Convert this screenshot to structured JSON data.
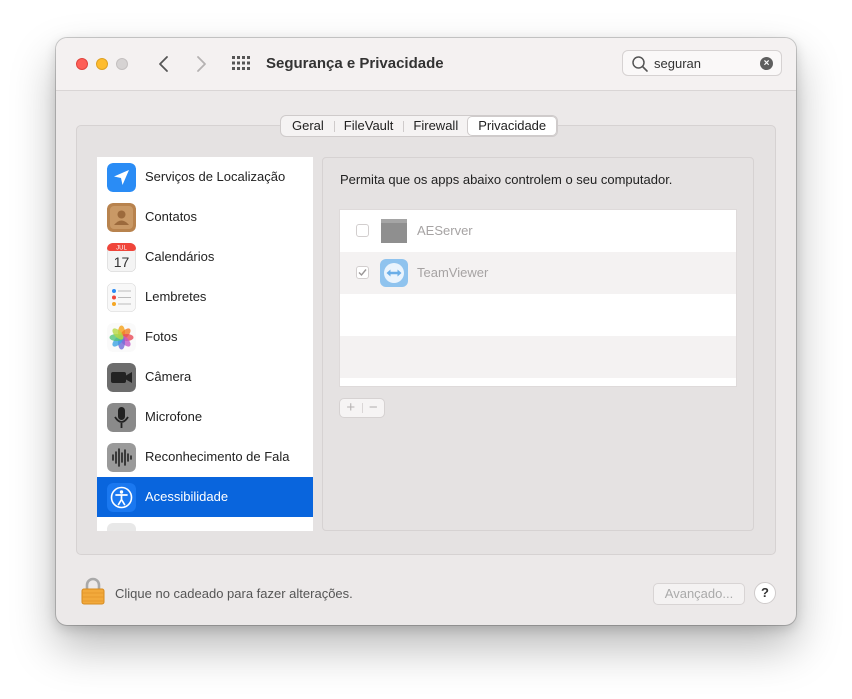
{
  "window": {
    "title": "Segurança e Privacidade"
  },
  "search": {
    "value": "seguran",
    "clear_glyph": "×"
  },
  "tabs": [
    {
      "label": "Geral",
      "selected": false
    },
    {
      "label": "FileVault",
      "selected": false
    },
    {
      "label": "Firewall",
      "selected": false
    },
    {
      "label": "Privacidade",
      "selected": true
    }
  ],
  "sidebar": {
    "items": [
      {
        "label": "Serviços de Localização",
        "icon": "location-icon"
      },
      {
        "label": "Contatos",
        "icon": "contacts-icon"
      },
      {
        "label": "Calendários",
        "icon": "calendar-icon",
        "icon_month": "JUL",
        "icon_day": "17"
      },
      {
        "label": "Lembretes",
        "icon": "reminders-icon"
      },
      {
        "label": "Fotos",
        "icon": "photos-icon"
      },
      {
        "label": "Câmera",
        "icon": "camera-icon"
      },
      {
        "label": "Microfone",
        "icon": "microphone-icon"
      },
      {
        "label": "Reconhecimento de Fala",
        "icon": "speech-recognition-icon"
      },
      {
        "label": "Acessibilidade",
        "icon": "accessibility-icon",
        "selected": true
      }
    ]
  },
  "content": {
    "description": "Permita que os apps abaixo controlem o seu computador.",
    "apps": [
      {
        "name": "AEServer",
        "checked": false,
        "icon": "aeserver-icon"
      },
      {
        "name": "TeamViewer",
        "checked": true,
        "icon": "teamviewer-icon"
      }
    ],
    "add_glyph": "+",
    "remove_glyph": "−"
  },
  "footer": {
    "lock_text": "Clique no cadeado para fazer alterações.",
    "advanced_label": "Avançado...",
    "help_label": "?"
  },
  "colors": {
    "selection": "#0965dd",
    "close": "#fe5f57",
    "minimize": "#febc2e"
  }
}
